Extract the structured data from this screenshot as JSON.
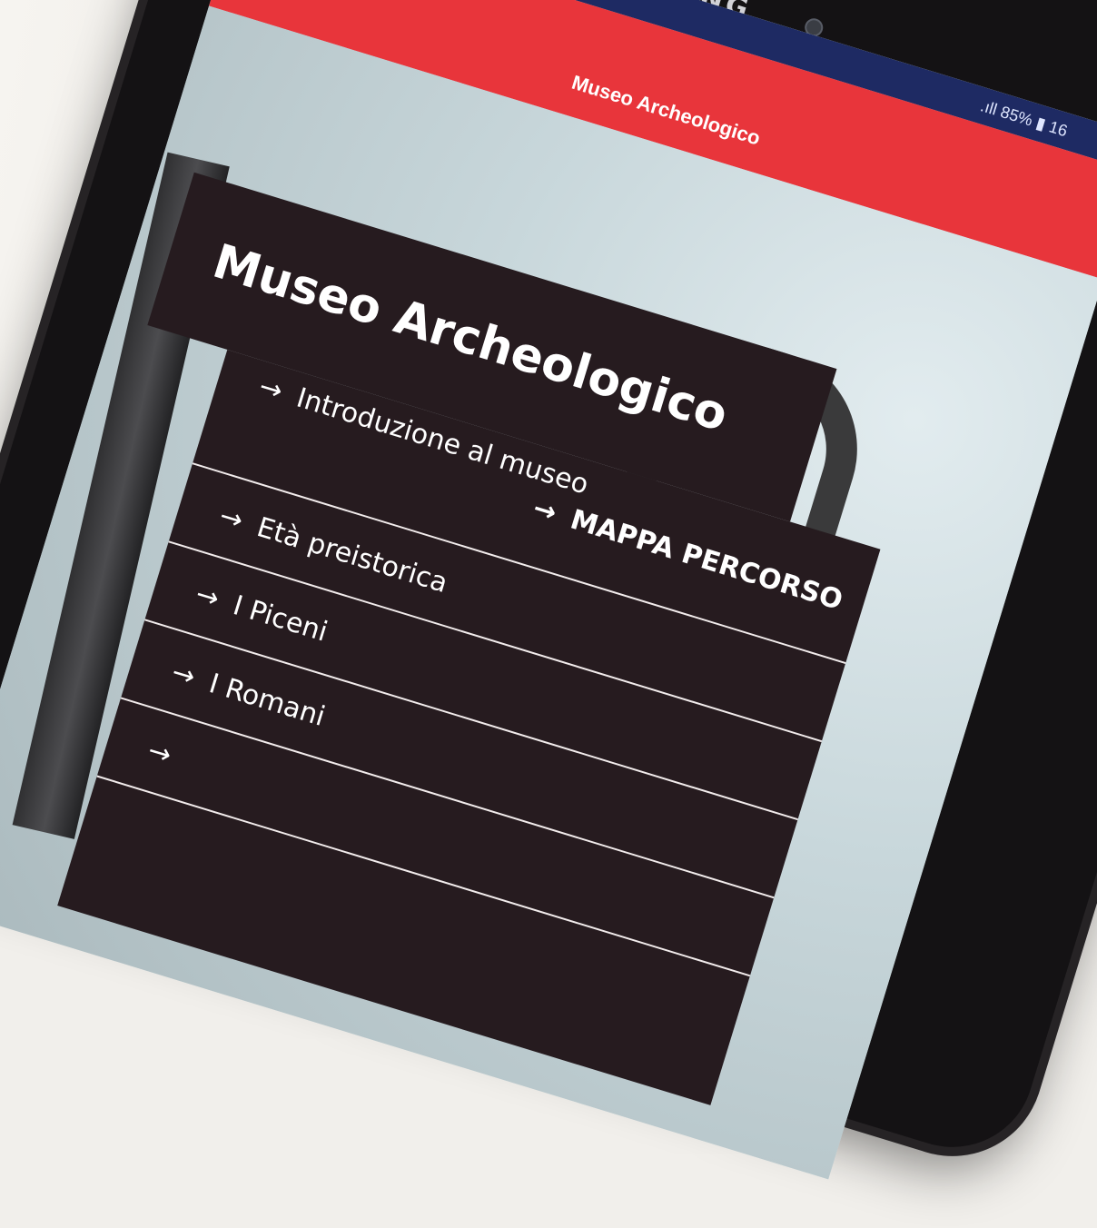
{
  "device": {
    "brand": "SAMSUNG",
    "status": {
      "signal": ".ıll",
      "battery_percent": "85%",
      "time_partial": "16"
    }
  },
  "appbar": {
    "back_icon": "back-arrow-icon",
    "title": "Museo Archeologico"
  },
  "content": {
    "title": "Museo Archeologico",
    "menu": [
      {
        "label": "Introduzione al museo"
      },
      {
        "label": "Età preistorica"
      },
      {
        "label": "I Piceni"
      },
      {
        "label": "I Romani"
      }
    ],
    "map_link": "MAPPA PERCORSO",
    "arrow_icon": "→"
  },
  "colors": {
    "statusbar": "#1e2a63",
    "appbar": "#e8353b",
    "panel": "#261b1f",
    "text": "#ffffff"
  }
}
